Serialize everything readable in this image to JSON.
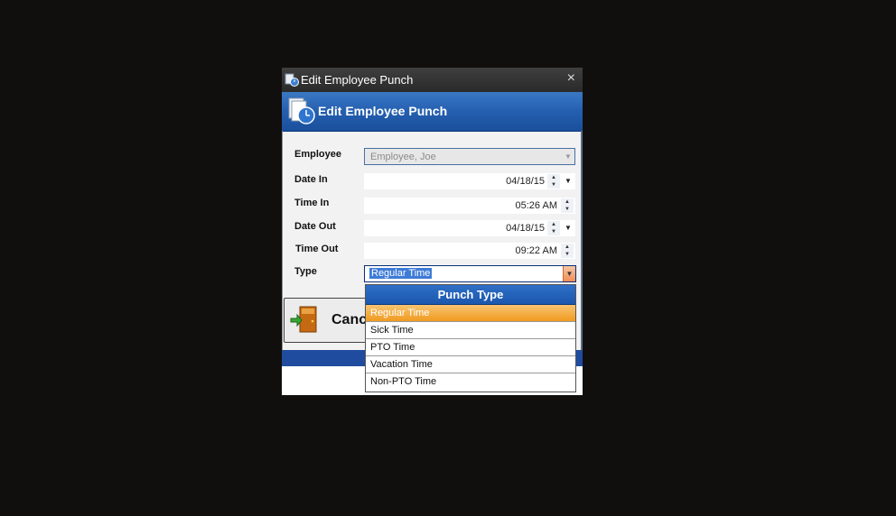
{
  "window": {
    "title": "Edit Employee Punch",
    "close_glyph": "×"
  },
  "banner": {
    "title": "Edit Employee Punch"
  },
  "form": {
    "employee": {
      "label": "Employee",
      "value": "Employee, Joe"
    },
    "date_in": {
      "label": "Date In",
      "value": "04/18/15"
    },
    "time_in": {
      "label": "Time In",
      "value": "05:26 AM"
    },
    "date_out": {
      "label": "Date Out",
      "value": "04/18/15"
    },
    "time_out": {
      "label": "Time Out",
      "value": "09:22 AM"
    },
    "type": {
      "label": "Type",
      "value": "Regular Time"
    }
  },
  "cancel_button": {
    "label": "Canc"
  },
  "popup": {
    "header": "Punch Type",
    "items": [
      "Regular Time",
      "Sick Time",
      "PTO Time",
      "Vacation Time",
      "Non-PTO Time"
    ],
    "selected": "Regular Time"
  },
  "icons": {
    "app": "punch-clock-icon",
    "banner": "punch-clock-icon",
    "exit": "exit-door-icon",
    "spin_up": "arrow-up-icon",
    "spin_down": "arrow-down-icon",
    "dropdown": "chevron-down-icon"
  },
  "colors": {
    "banner": "#245faf",
    "selection": "#3e7bd7",
    "popup_selected": "#f09a1f",
    "titlebar": "#333333"
  }
}
